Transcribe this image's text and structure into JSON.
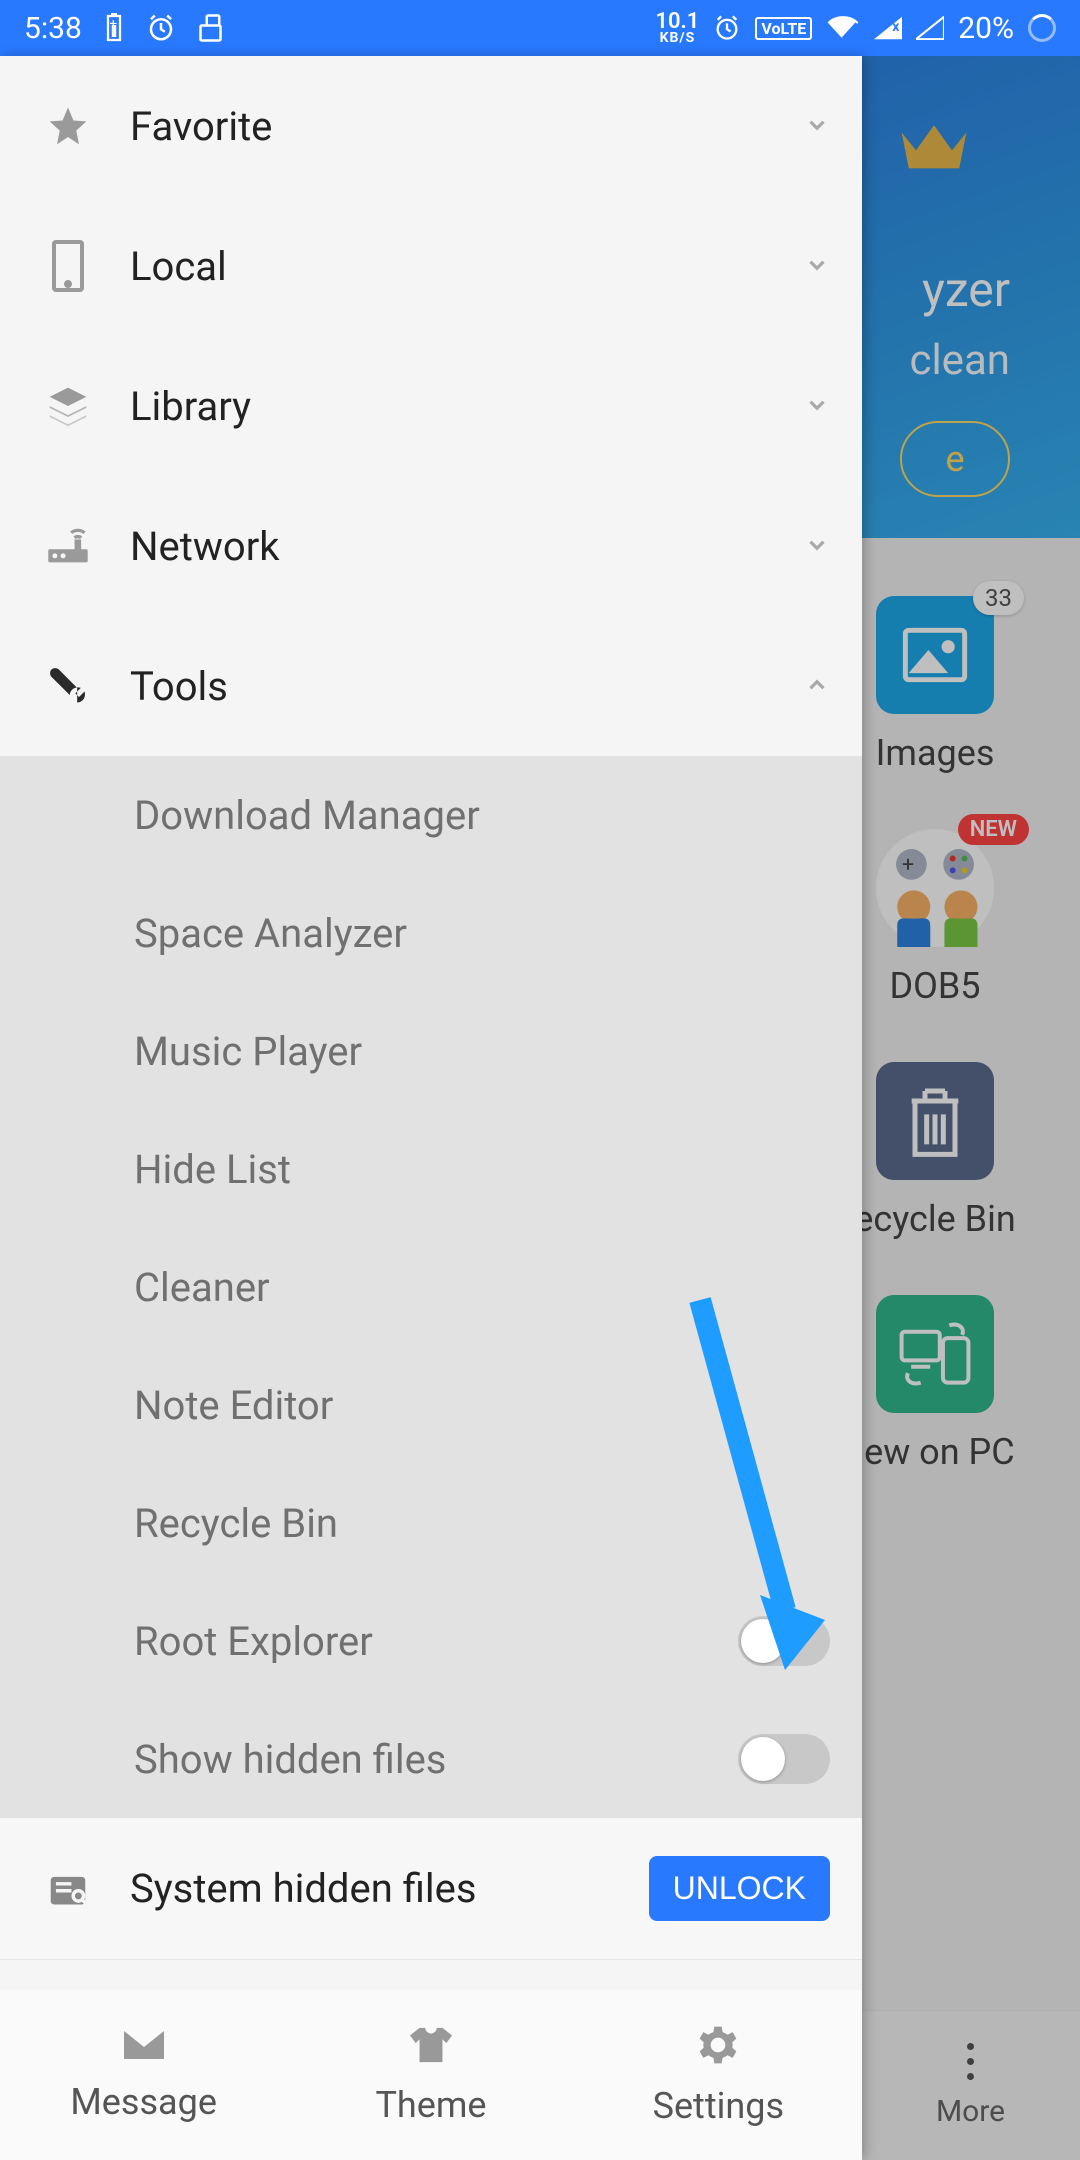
{
  "status": {
    "time": "5:38",
    "speed_value": "10.1",
    "speed_unit": "KB/S",
    "volte": "VoLTE",
    "battery": "20%"
  },
  "background": {
    "title": "yzer",
    "subtitle": "clean",
    "button": "e",
    "grid": [
      {
        "label": "Images",
        "badge": "33"
      },
      {
        "label": "DOB5",
        "badge_new": "NEW"
      },
      {
        "label": "ecycle Bin"
      },
      {
        "label": "iew on PC"
      }
    ]
  },
  "drawer": {
    "sections": [
      {
        "id": "favorite",
        "label": "Favorite",
        "expanded": false
      },
      {
        "id": "local",
        "label": "Local",
        "expanded": false
      },
      {
        "id": "library",
        "label": "Library",
        "expanded": false
      },
      {
        "id": "network",
        "label": "Network",
        "expanded": false
      },
      {
        "id": "tools",
        "label": "Tools",
        "expanded": true
      }
    ],
    "tools": [
      {
        "label": "Download Manager"
      },
      {
        "label": "Space Analyzer"
      },
      {
        "label": "Music Player"
      },
      {
        "label": "Hide List"
      },
      {
        "label": "Cleaner"
      },
      {
        "label": "Note Editor"
      },
      {
        "label": "Recycle Bin"
      },
      {
        "label": "Root Explorer",
        "toggle": false
      },
      {
        "label": "Show hidden files",
        "toggle": false
      }
    ],
    "system_hidden": {
      "label": "System hidden files",
      "button": "UNLOCK"
    },
    "bottom": [
      {
        "id": "message",
        "label": "Message"
      },
      {
        "id": "theme",
        "label": "Theme"
      },
      {
        "id": "settings",
        "label": "Settings"
      }
    ]
  },
  "bottom_nav": {
    "more": "More"
  }
}
